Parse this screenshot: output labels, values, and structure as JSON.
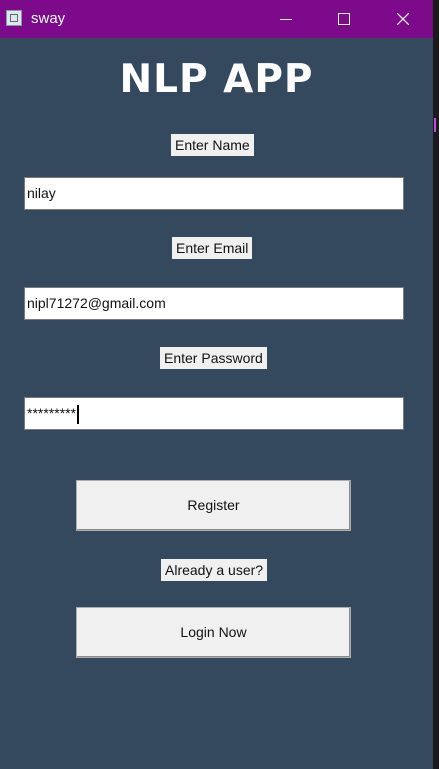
{
  "window": {
    "title": "sway",
    "controls": {
      "minimize_icon": "minimize-icon",
      "maximize_icon": "maximize-icon",
      "close_icon": "close-icon"
    },
    "titlebar_color": "#7c0a8a",
    "background_color": "#34495e"
  },
  "app": {
    "heading": "NLP APP"
  },
  "form": {
    "name_label": "Enter Name",
    "name_value": "nilay",
    "email_label": "Enter Email",
    "email_value": "nipl71272@gmail.com",
    "password_label": "Enter Password",
    "password_masked": "*********",
    "register_button": "Register",
    "already_user_label": "Already a user?",
    "login_button": "Login Now"
  }
}
